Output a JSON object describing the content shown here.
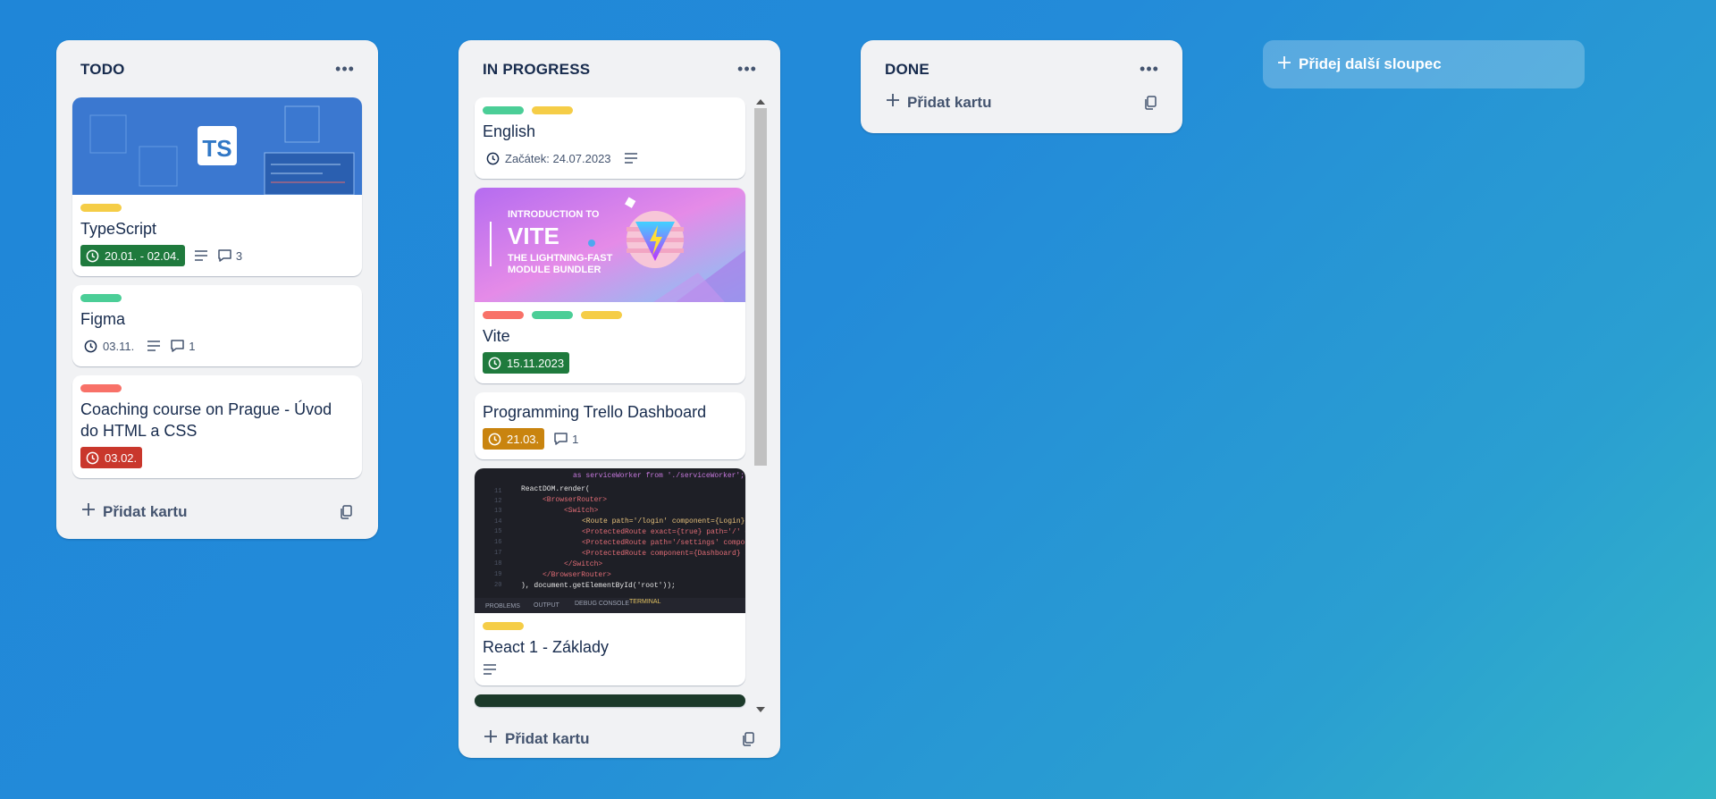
{
  "colors": {
    "label_yellow": "#f5cd47",
    "label_green": "#4bce97",
    "label_red": "#f87168",
    "date_green": "#1f7a3d",
    "date_red": "#c9372c",
    "date_orange": "#c9840f"
  },
  "columns": [
    {
      "title": "TODO",
      "add_card": "Přidat kartu",
      "cards": [
        {
          "cover": "typescript",
          "cover_text": "TS",
          "title": "TypeScript",
          "date": "20.01. - 02.04.",
          "comments": "3"
        },
        {
          "title": "Figma",
          "date": "03.11.",
          "comments": "1"
        },
        {
          "title": "Coaching course on Prague - Úvod do HTML a CSS",
          "date": "03.02."
        }
      ]
    },
    {
      "title": "IN PROGRESS",
      "add_card": "Přidat kartu",
      "cards": [
        {
          "title": "English",
          "date": "Začátek: 24.07.2023"
        },
        {
          "cover": "vite",
          "cover_line1": "INTRODUCTION TO",
          "cover_line2": "VITE",
          "cover_line3": "THE LIGHTNING-FAST",
          "cover_line4": "MODULE BUNDLER",
          "title": "Vite",
          "date": "15.11.2023"
        },
        {
          "title": "Programming Trello Dashboard",
          "date": "21.03.",
          "comments": "1"
        },
        {
          "cover": "react-code",
          "code_lines": [
            "as serviceWorker from './serviceWorker';",
            "ReactDOM.render(",
            "<BrowserRouter>",
            "<Switch>",
            "<Route path='/login' component={Login} />",
            "<ProtectedRoute exact={true} path='/' component={Dashboard} />",
            "<ProtectedRoute path='/settings' component={Dashboard} />",
            "<ProtectedRoute component={Dashboard} />",
            "</Switch>",
            "</BrowserRouter>",
            "), document.getElementById('root'));"
          ],
          "line_numbers": [
            "11",
            "12",
            "13",
            "14",
            "15",
            "16",
            "17",
            "18",
            "19",
            "20"
          ],
          "tabs": [
            "PROBLEMS",
            "OUTPUT",
            "DEBUG CONSOLE",
            "TERMINAL"
          ],
          "title": "React 1 - Základy"
        }
      ]
    },
    {
      "title": "DONE",
      "add_card": "Přidat kartu",
      "cards": []
    }
  ],
  "add_column": "Přidej další sloupec"
}
